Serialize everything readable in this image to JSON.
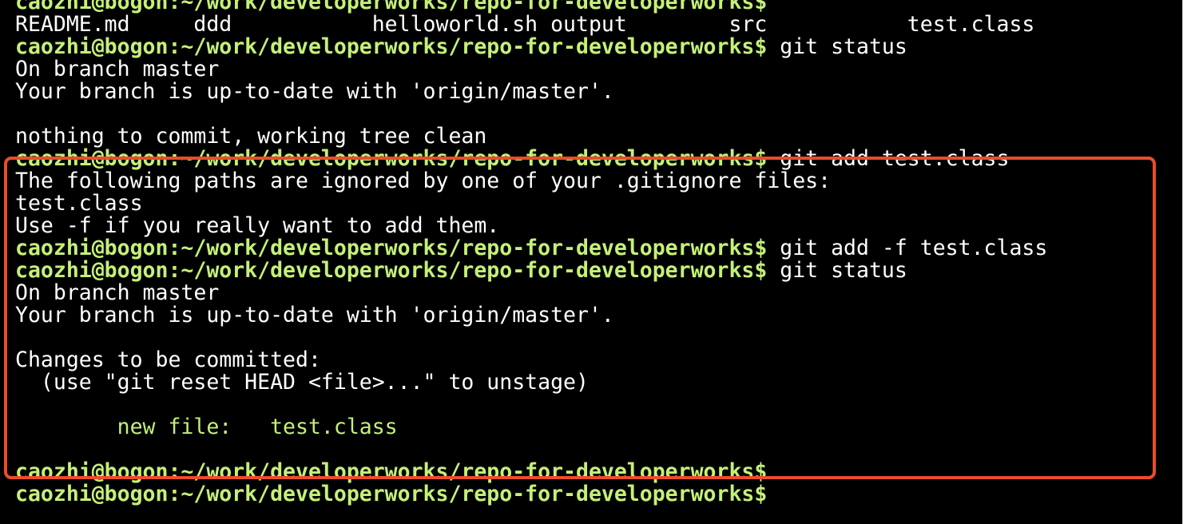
{
  "terminal": {
    "lines": [
      {
        "prompt": "caozhi@bogon:~/work/developerworks/repo-for-developerworks$",
        "command": "",
        "kind": "prompt"
      },
      {
        "text": "README.md     ddd           helloworld.sh output        src           test.class",
        "kind": "output"
      },
      {
        "prompt": "caozhi@bogon:~/work/developerworks/repo-for-developerworks$",
        "command": " git status",
        "kind": "prompt"
      },
      {
        "text": "On branch master",
        "kind": "output"
      },
      {
        "text": "Your branch is up-to-date with 'origin/master'.",
        "kind": "output"
      },
      {
        "text": "",
        "kind": "output"
      },
      {
        "text": "nothing to commit, working tree clean",
        "kind": "output"
      },
      {
        "prompt": "caozhi@bogon:~/work/developerworks/repo-for-developerworks$",
        "command": " git add test.class",
        "kind": "prompt"
      },
      {
        "text": "The following paths are ignored by one of your .gitignore files:",
        "kind": "output"
      },
      {
        "text": "test.class",
        "kind": "output"
      },
      {
        "text": "Use -f if you really want to add them.",
        "kind": "output"
      },
      {
        "prompt": "caozhi@bogon:~/work/developerworks/repo-for-developerworks$",
        "command": " git add -f test.class",
        "kind": "prompt"
      },
      {
        "prompt": "caozhi@bogon:~/work/developerworks/repo-for-developerworks$",
        "command": " git status",
        "kind": "prompt"
      },
      {
        "text": "On branch master",
        "kind": "output"
      },
      {
        "text": "Your branch is up-to-date with 'origin/master'.",
        "kind": "output"
      },
      {
        "text": "",
        "kind": "output"
      },
      {
        "text": "Changes to be committed:",
        "kind": "output"
      },
      {
        "text": "  (use \"git reset HEAD <file>...\" to unstage)",
        "kind": "output"
      },
      {
        "text": "",
        "kind": "output"
      },
      {
        "text": "        new file:   test.class",
        "kind": "staged"
      },
      {
        "text": "",
        "kind": "output"
      },
      {
        "prompt": "caozhi@bogon:~/work/developerworks/repo-for-developerworks$",
        "command": "",
        "kind": "prompt"
      },
      {
        "prompt": "caozhi@bogon:~/work/developerworks/repo-for-developerworks$",
        "command": "",
        "kind": "prompt"
      }
    ]
  },
  "colors": {
    "background": "#000000",
    "prompt": "#c4f078",
    "text": "#ffffff",
    "staged": "#c4f078",
    "highlight_border": "#ea4d2a"
  }
}
